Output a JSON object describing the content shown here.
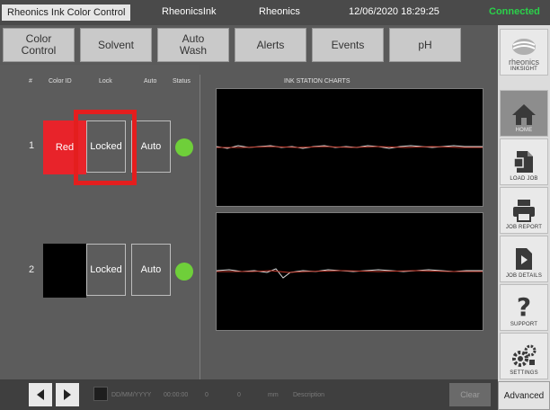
{
  "titlebar": {
    "app_title": "Rheonics Ink Color Control",
    "item2": "RheonicsInk",
    "item3": "Rheonics",
    "datetime": "12/06/2020 18:29:25",
    "status": "Connected",
    "status_color": "#2bd14a"
  },
  "topnav": {
    "color_control": "Color\nControl",
    "solvent": "Solvent",
    "auto_wash": "Auto\nWash",
    "alerts": "Alerts",
    "events": "Events",
    "ph": "pH"
  },
  "sidebar": {
    "logo_text": "rheonics",
    "logo_sub": "INKSIGHT",
    "items": [
      {
        "label": "HOME",
        "icon": "home-icon"
      },
      {
        "label": "LOAD JOB",
        "icon": "document-icon"
      },
      {
        "label": "JOB REPORT",
        "icon": "printer-icon"
      },
      {
        "label": "JOB DETAILS",
        "icon": "play-document-icon"
      },
      {
        "label": "SUPPORT",
        "icon": "question-icon"
      },
      {
        "label": "SETTINGS",
        "icon": "gears-icon"
      }
    ]
  },
  "table": {
    "headers": {
      "num": "#",
      "color_id": "Color ID",
      "lock": "Lock",
      "auto": "Auto",
      "status": "Status"
    },
    "rows": [
      {
        "num": "1",
        "color_id": "Red",
        "swatch": "#e8232a",
        "lock": "Locked",
        "auto": "Auto",
        "status_color": "#6fcf3a"
      },
      {
        "num": "2",
        "color_id": "",
        "swatch": "#000000",
        "lock": "Locked",
        "auto": "Auto",
        "status_color": "#6fcf3a"
      }
    ]
  },
  "charts": {
    "title": "INK STATION CHARTS"
  },
  "bottombar": {
    "date_placeholder": "DD/MM/YYYY",
    "time": "00:00:00",
    "val1": "0",
    "val2": "0",
    "unit": "mm",
    "description": "Description",
    "clear": "Clear",
    "advanced": "Advanced"
  }
}
